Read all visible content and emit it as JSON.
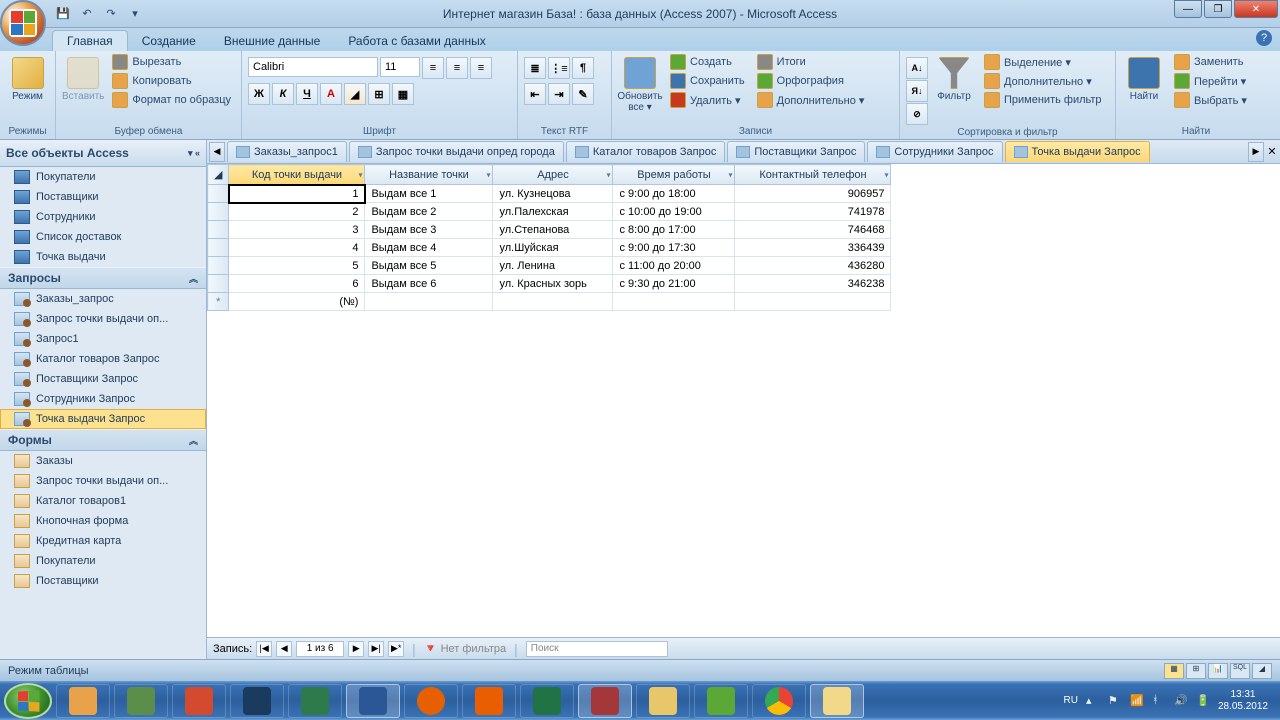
{
  "title": "Интернет магазин База! : база данных (Access 2007) - Microsoft Access",
  "ribbon": {
    "tabs": [
      "Главная",
      "Создание",
      "Внешние данные",
      "Работа с базами данных"
    ],
    "active_tab": 0,
    "groups": {
      "views": {
        "label": "Режимы",
        "mode": "Режим"
      },
      "clipboard": {
        "label": "Буфер обмена",
        "paste": "Вставить",
        "cut": "Вырезать",
        "copy": "Копировать",
        "format": "Формат по образцу"
      },
      "font": {
        "label": "Шрифт",
        "name": "Calibri",
        "size": "11"
      },
      "richtext": {
        "label": "Текст RTF"
      },
      "records": {
        "label": "Записи",
        "refresh": "Обновить все ▾",
        "create": "Создать",
        "save": "Сохранить",
        "delete": "Удалить ▾",
        "totals": "Итоги",
        "spelling": "Орфография",
        "more": "Дополнительно ▾"
      },
      "sortfilter": {
        "label": "Сортировка и фильтр",
        "filter": "Фильтр",
        "selection": "Выделение ▾",
        "advanced": "Дополнительно ▾",
        "toggle": "Применить фильтр"
      },
      "find": {
        "label": "Найти",
        "find": "Найти",
        "replace": "Заменить",
        "goto": "Перейти ▾",
        "select": "Выбрать ▾"
      }
    }
  },
  "nav": {
    "header": "Все объекты Access",
    "tables": [
      "Покупатели",
      "Поставщики",
      "Сотрудники",
      "Список доставок",
      "Точка выдачи"
    ],
    "queries_label": "Запросы",
    "queries": [
      "Заказы_запрос",
      "Запрос точки выдачи оп...",
      "Запрос1",
      "Каталог товаров Запрос",
      "Поставщики Запрос",
      "Сотрудники Запрос",
      "Точка выдачи Запрос"
    ],
    "queries_selected": 6,
    "forms_label": "Формы",
    "forms": [
      "Заказы",
      "Запрос точки выдачи оп...",
      "Каталог товаров1",
      "Кнопочная форма",
      "Кредитная карта",
      "Покупатели",
      "Поставщики"
    ]
  },
  "doc_tabs": [
    "Заказы_запрос1",
    "Запрос точки выдачи опред города",
    "Каталог товаров Запрос",
    "Поставщики Запрос",
    "Сотрудники Запрос",
    "Точка выдачи Запрос"
  ],
  "doc_active": 5,
  "grid": {
    "columns": [
      "Код точки выдачи",
      "Название точки",
      "Адрес",
      "Время работы",
      "Контактный телефон"
    ],
    "selected_col": 0,
    "rows": [
      {
        "id": "1",
        "name": "Выдам все 1",
        "addr": "ул. Кузнецова",
        "time": "с 9:00 до 18:00",
        "phone": "906957"
      },
      {
        "id": "2",
        "name": "Выдам все 2",
        "addr": "ул.Палехская",
        "time": "с 10:00 до 19:00",
        "phone": "741978"
      },
      {
        "id": "3",
        "name": "Выдам все 3",
        "addr": "ул.Степанова",
        "time": "с 8:00 до 17:00",
        "phone": "746468"
      },
      {
        "id": "4",
        "name": "Выдам все 4",
        "addr": "ул.Шуйская",
        "time": "с 9:00 до 17:30",
        "phone": "336439"
      },
      {
        "id": "5",
        "name": "Выдам все 5",
        "addr": "ул. Ленина",
        "time": "с 11:00 до 20:00",
        "phone": "436280"
      },
      {
        "id": "6",
        "name": "Выдам все 6",
        "addr": "ул. Красных зорь",
        "time": "с 9:30 до 21:00",
        "phone": "346238"
      }
    ],
    "new_row": "(№)"
  },
  "record_nav": {
    "label": "Запись:",
    "pos": "1 из 6",
    "no_filter": "Нет фильтра",
    "search": "Поиск"
  },
  "statusbar": {
    "mode": "Режим таблицы"
  },
  "tray": {
    "lang": "RU",
    "time": "13:31",
    "date": "28.05.2012"
  }
}
